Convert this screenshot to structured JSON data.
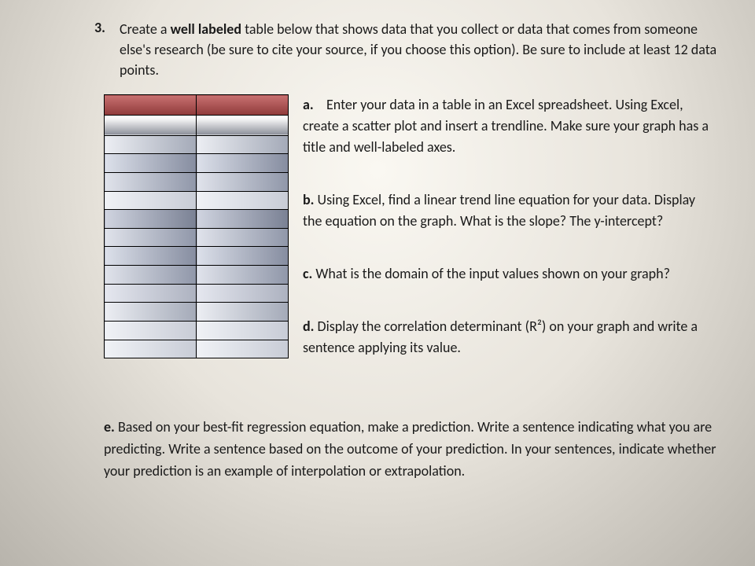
{
  "question": {
    "number": "3.",
    "prompt_pre": "Create a ",
    "prompt_bold": "well labeled",
    "prompt_post": " table below that shows data that you collect or data that comes from someone else's research (be sure to cite your source, if you choose this option). Be sure to include at least 12 data points."
  },
  "parts": {
    "a": {
      "label": "a.",
      "text": "Enter your data in a table in an Excel spreadsheet. Using Excel, create a scatter plot and insert a trendline.  Make sure your graph has a title and well-labeled axes."
    },
    "b": {
      "label": "b.",
      "text": " Using Excel, find a linear trend line equation for your data.  Display the equation on the graph.  What is the slope? The y-intercept?"
    },
    "c": {
      "label": "c.",
      "text": " What is the domain of the input values shown on your graph?"
    },
    "d": {
      "label": "d.",
      "text": " Display the correlation determinant (R²) on your graph and write a sentence applying its value."
    },
    "e": {
      "label": "e.",
      "text": " Based on your best-fit regression equation, make a prediction. Write a sentence indicating what you are predicting. Write a sentence based on the outcome of your prediction. In your sentences, indicate whether your prediction is an example of interpolation or extrapolation."
    }
  }
}
